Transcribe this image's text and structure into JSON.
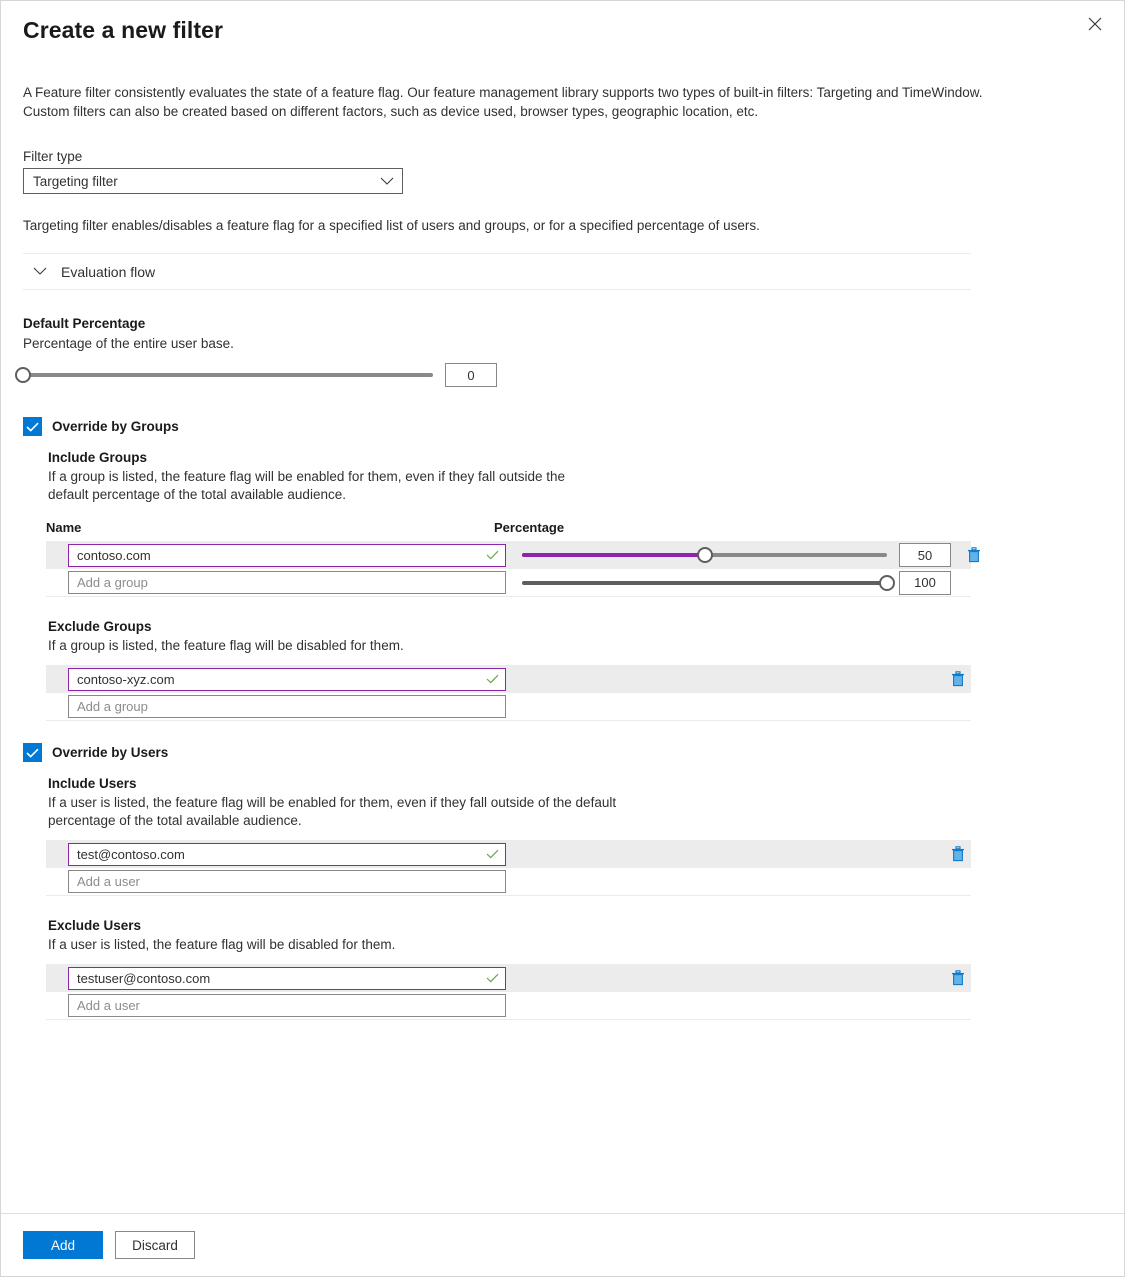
{
  "panel": {
    "title": "Create a new filter",
    "close_icon": "close-icon",
    "intro": "A Feature filter consistently evaluates the state of a feature flag. Our feature management library supports two types of built-in filters: Targeting and TimeWindow. Custom filters can also be created based on different factors, such as device used, browser types, geographic location, etc."
  },
  "filter_type": {
    "label": "Filter type",
    "value": "Targeting filter",
    "chevron_icon": "chevron-down-icon",
    "description": "Targeting filter enables/disables a feature flag for a specified list of users and groups, or for a specified percentage of users."
  },
  "evaluation_flow": {
    "label": "Evaluation flow",
    "chevron_icon": "chevron-down-icon",
    "expanded": "false"
  },
  "default_percentage": {
    "title": "Default Percentage",
    "description": "Percentage of the entire user base.",
    "value": "0",
    "min": "0",
    "max": "100"
  },
  "override_by_groups": {
    "label": "Override by Groups",
    "checked": "true",
    "include": {
      "title": "Include Groups",
      "description": "If a group is listed, the feature flag will be enabled for them, even if they fall outside the default percentage of the total available audience.",
      "columns": {
        "name": "Name",
        "percentage": "Percentage"
      },
      "rows": [
        {
          "name": "contoso.com",
          "name_placeholder": "",
          "percentage": "50",
          "valid": "true",
          "has_delete": "true",
          "delete_icon": "trash-icon",
          "valid_icon": "check-icon"
        },
        {
          "name": "",
          "name_placeholder": "Add a group",
          "percentage": "100",
          "valid": "false",
          "has_delete": "false",
          "delete_icon": "trash-icon",
          "valid_icon": "check-icon"
        }
      ]
    },
    "exclude": {
      "title": "Exclude Groups",
      "description": "If a group is listed, the feature flag will be disabled for them.",
      "rows": [
        {
          "name": "contoso-xyz.com",
          "name_placeholder": "",
          "valid": "true",
          "has_delete": "true",
          "delete_icon": "trash-icon",
          "valid_icon": "check-icon"
        },
        {
          "name": "",
          "name_placeholder": "Add a group",
          "valid": "false",
          "has_delete": "false",
          "delete_icon": "trash-icon",
          "valid_icon": "check-icon"
        }
      ]
    }
  },
  "override_by_users": {
    "label": "Override by Users",
    "checked": "true",
    "include": {
      "title": "Include Users",
      "description": "If a user is listed, the feature flag will be enabled for them, even if they fall outside of the default percentage of the total available audience.",
      "rows": [
        {
          "name": "test@contoso.com",
          "name_placeholder": "",
          "valid": "true",
          "has_delete": "true",
          "delete_icon": "trash-icon",
          "valid_icon": "check-icon"
        },
        {
          "name": "",
          "name_placeholder": "Add a user",
          "valid": "false",
          "has_delete": "false",
          "delete_icon": "trash-icon",
          "valid_icon": "check-icon"
        }
      ]
    },
    "exclude": {
      "title": "Exclude Users",
      "description": "If a user is listed, the feature flag will be disabled for them.",
      "rows": [
        {
          "name": "testuser@contoso.com",
          "name_placeholder": "",
          "valid": "true",
          "has_delete": "true",
          "delete_icon": "trash-icon",
          "valid_icon": "check-icon"
        },
        {
          "name": "",
          "name_placeholder": "Add a user",
          "valid": "false",
          "has_delete": "false",
          "delete_icon": "trash-icon",
          "valid_icon": "check-icon"
        }
      ]
    }
  },
  "footer": {
    "add_label": "Add",
    "discard_label": "Discard"
  },
  "colors": {
    "accent": "#0078d4",
    "slider_fill": "#8e24aa",
    "valid_border": "#8e24aa",
    "valid_check": "#6aa84f",
    "row_highlight": "#ececec",
    "trash": "#0f7ac8"
  }
}
